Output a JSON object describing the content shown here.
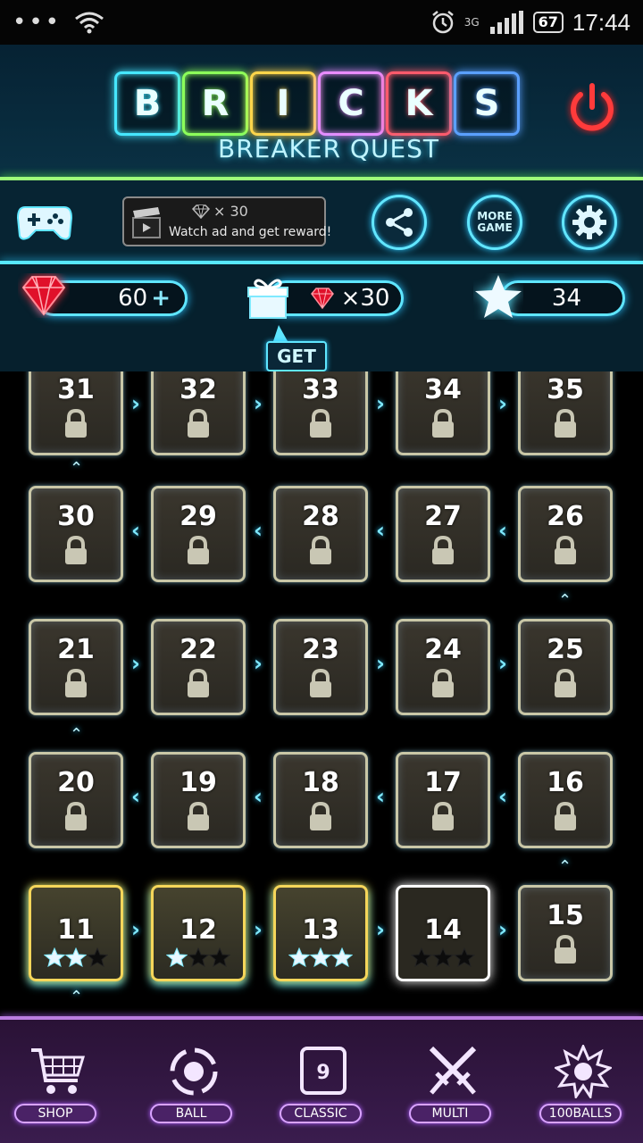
{
  "status_bar": {
    "time": "17:44",
    "battery": "67",
    "network": "3G"
  },
  "header": {
    "title_letters": [
      "B",
      "R",
      "I",
      "C",
      "K",
      "S"
    ],
    "title_colors": [
      "#46e7ff",
      "#8cff5a",
      "#ffd54a",
      "#e98cff",
      "#ff5a6b",
      "#5aa0ff"
    ],
    "subtitle": "BREAKER  QUEST"
  },
  "toolbar": {
    "ad_reward": "× 30",
    "ad_message": "Watch ad and get reward!",
    "more_game_line1": "MORE",
    "more_game_line2": "GAME"
  },
  "currency": {
    "gems": "60",
    "gift_reward": "×30",
    "get_label": "GET",
    "stars": "34"
  },
  "levels": [
    {
      "num": "31",
      "locked": true
    },
    {
      "num": "32",
      "locked": true
    },
    {
      "num": "33",
      "locked": true
    },
    {
      "num": "34",
      "locked": true
    },
    {
      "num": "35",
      "locked": true
    },
    {
      "num": "30",
      "locked": true
    },
    {
      "num": "29",
      "locked": true
    },
    {
      "num": "28",
      "locked": true
    },
    {
      "num": "27",
      "locked": true
    },
    {
      "num": "26",
      "locked": true
    },
    {
      "num": "21",
      "locked": true
    },
    {
      "num": "22",
      "locked": true
    },
    {
      "num": "23",
      "locked": true
    },
    {
      "num": "24",
      "locked": true
    },
    {
      "num": "25",
      "locked": true
    },
    {
      "num": "20",
      "locked": true
    },
    {
      "num": "19",
      "locked": true
    },
    {
      "num": "18",
      "locked": true
    },
    {
      "num": "17",
      "locked": true
    },
    {
      "num": "16",
      "locked": true
    },
    {
      "num": "11",
      "locked": false,
      "stars": 2
    },
    {
      "num": "12",
      "locked": false,
      "stars": 1
    },
    {
      "num": "13",
      "locked": false,
      "stars": 3
    },
    {
      "num": "14",
      "locked": false,
      "stars": 0,
      "current": true
    },
    {
      "num": "15",
      "locked": true
    }
  ],
  "bottom_nav": {
    "shop": "SHOP",
    "ball": "BALL",
    "classic": "CLASSIC",
    "classic_icon_number": "9",
    "multi": "MULTI",
    "hundred_balls": "100BALLS"
  },
  "colors": {
    "neon_blue": "#57e8ff",
    "neon_green": "#9dff7a",
    "gem_red": "#ff2a3c",
    "star_blue": "#dff6ff",
    "purple_bar": "#3a1c4e"
  }
}
